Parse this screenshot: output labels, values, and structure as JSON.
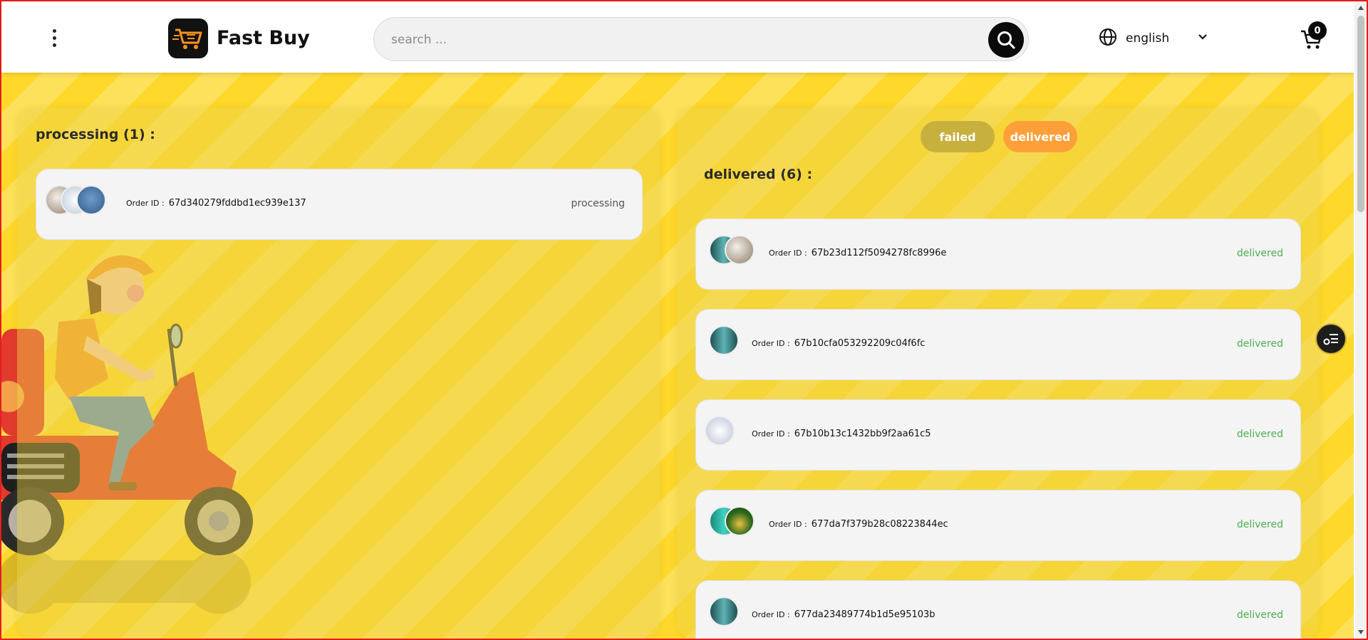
{
  "header": {
    "brand": "Fast Buy",
    "search_placeholder": "search ...",
    "language": "english",
    "cart_count": "0"
  },
  "processing": {
    "title": "processing (1) :",
    "orders": [
      {
        "label": "Order ID :",
        "id": "67d340279fddbd1ec939e137",
        "status": "processing"
      }
    ]
  },
  "filters": {
    "failed": "failed",
    "delivered": "delivered"
  },
  "delivered": {
    "title": "delivered (6) :",
    "orders": [
      {
        "label": "Order ID :",
        "id": "67b23d112f5094278fc8996e",
        "status": "delivered"
      },
      {
        "label": "Order ID :",
        "id": "67b10cfa053292209c04f6fc",
        "status": "delivered"
      },
      {
        "label": "Order ID :",
        "id": "67b10b13c1432bb9f2aa61c5",
        "status": "delivered"
      },
      {
        "label": "Order ID :",
        "id": "677da7f379b28c08223844ec",
        "status": "delivered"
      },
      {
        "label": "Order ID :",
        "id": "677da23489774b1d5e95103b",
        "status": "delivered"
      }
    ]
  },
  "colors": {
    "background": "#fed82a",
    "delivered_status": "#4caf50",
    "failed_pill": "#c7b03e",
    "delivered_pill": "#ff9f3a"
  },
  "icons": [
    "menu-dots-icon",
    "cart-logo-icon",
    "search-icon",
    "globe-icon",
    "chevron-down-icon",
    "cart-icon",
    "filter-list-icon"
  ]
}
